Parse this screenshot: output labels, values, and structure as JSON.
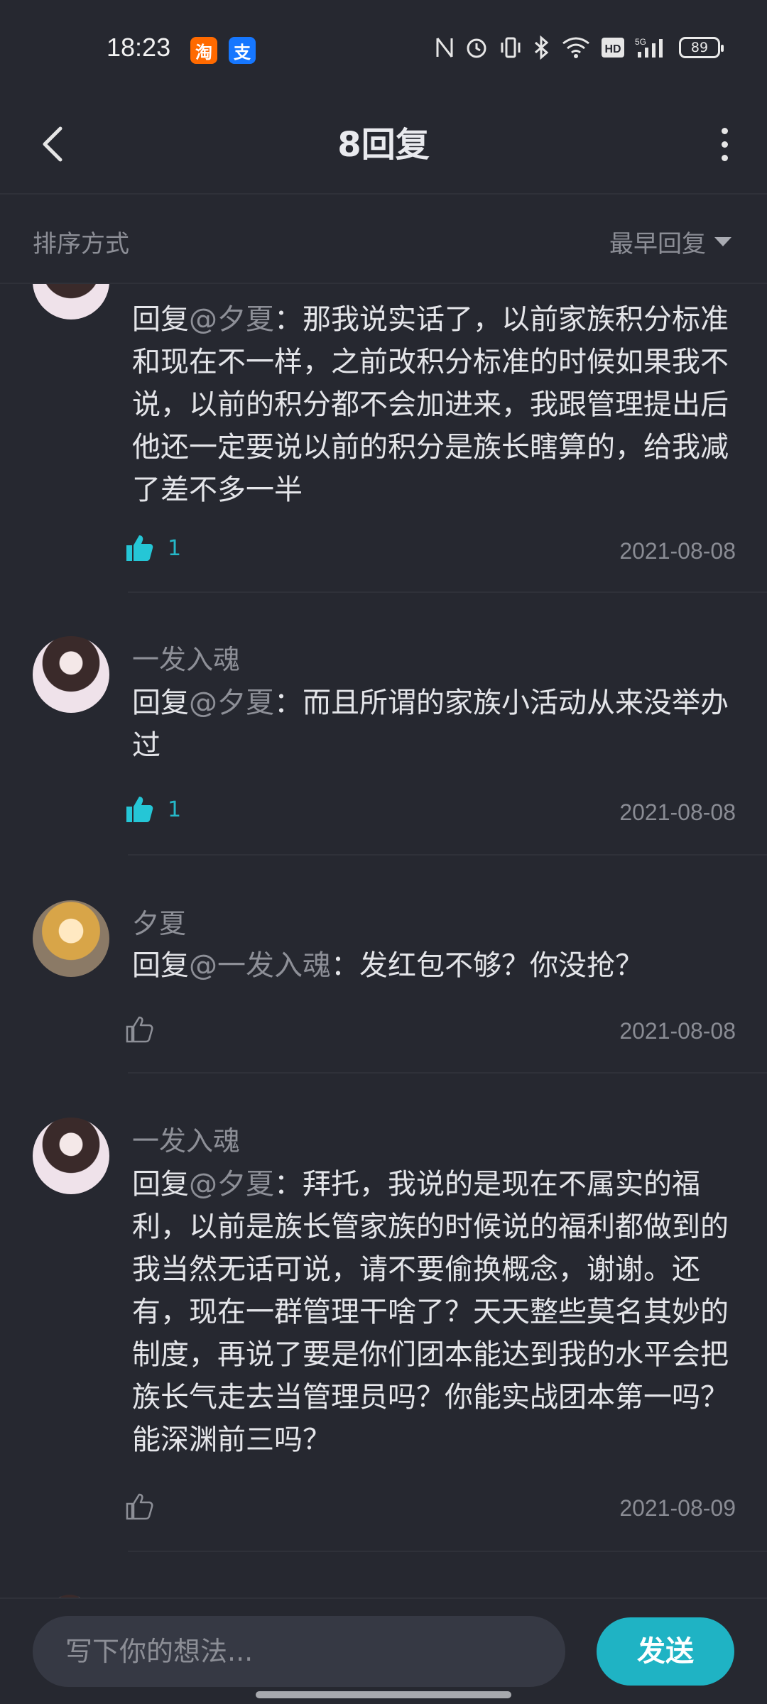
{
  "status_bar": {
    "time": "18:23",
    "app_badges": [
      "淘",
      "支"
    ],
    "battery": "89"
  },
  "header": {
    "title": "8回复"
  },
  "sort": {
    "label": "排序方式",
    "selected": "最早回复"
  },
  "replies": [
    {
      "username": "",
      "reply_prefix": "回复",
      "mention": "@夕夏",
      "text": "：那我说实话了，以前家族积分标准和现在不一样，之前改积分标准的时候如果我不说，以前的积分都不会加进来，我跟管理提出后他还一定要说以前的积分是族长瞎算的，给我减了差不多一半",
      "likes": "1",
      "date": "2021-08-08"
    },
    {
      "username": "一发入魂",
      "reply_prefix": "回复",
      "mention": "@夕夏",
      "text": "：而且所谓的家族小活动从来没举办过",
      "likes": "1",
      "date": "2021-08-08"
    },
    {
      "username": "夕夏",
      "reply_prefix": "回复",
      "mention": "@一发入魂",
      "text": "：发红包不够？你没抢？",
      "likes": "",
      "date": "2021-08-08"
    },
    {
      "username": "一发入魂",
      "reply_prefix": "回复",
      "mention": "@夕夏",
      "text": "：拜托，我说的是现在不属实的福利，以前是族长管家族的时候说的福利都做到的我当然无话可说，请不要偷换概念，谢谢。还有，现在一群管理干啥了？天天整些莫名其妙的制度，再说了要是你们团本能达到我的水平会把族长气走去当管理员吗？你能实战团本第一吗？能深渊前三吗？",
      "likes": "",
      "date": "2021-08-09"
    }
  ],
  "input": {
    "placeholder": "写下你的想法..."
  },
  "send_label": "发送",
  "colors": {
    "background": "#262830",
    "accent": "#1fb3c4",
    "like_active": "#25b8c8",
    "muted_text": "#8d8f97"
  },
  "icons": [
    "back-arrow-icon",
    "more-vertical-icon",
    "caret-down-icon",
    "thumbs-up-icon"
  ]
}
